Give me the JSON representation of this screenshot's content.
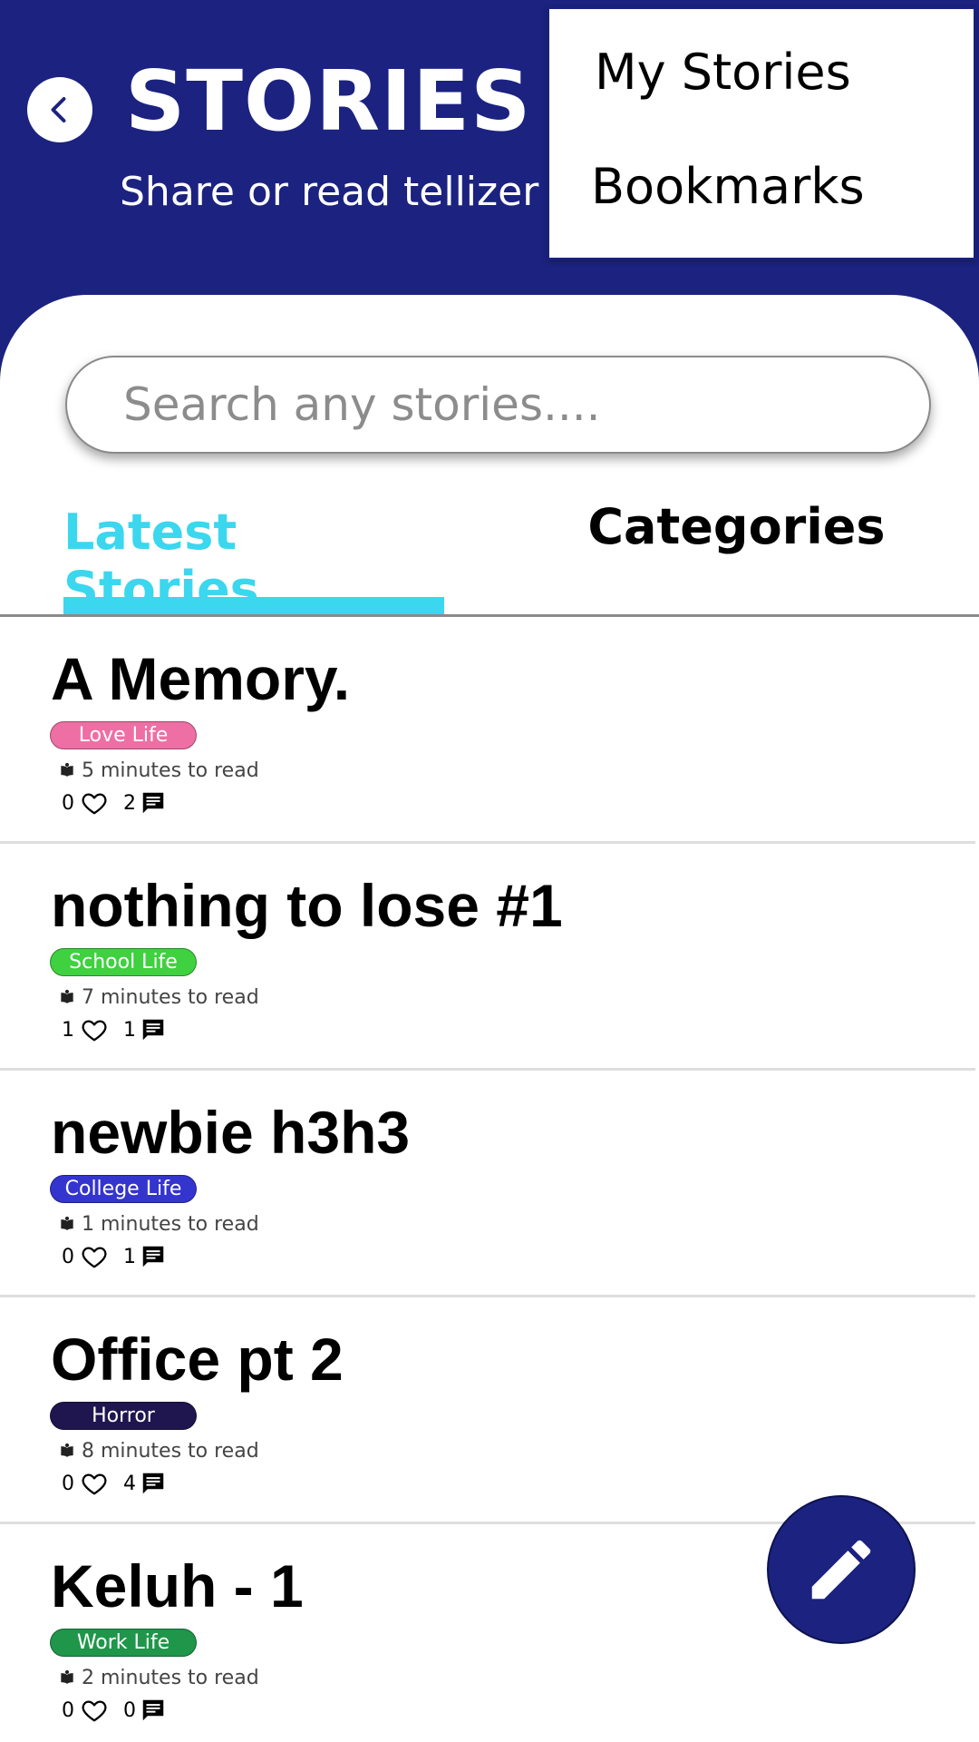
{
  "header": {
    "title": "STORIES",
    "subtitle": "Share or read tellizer",
    "back_icon": "chevron-left-icon",
    "background_color": "#1b227f"
  },
  "menu": {
    "items": [
      "My Stories",
      "Bookmarks"
    ]
  },
  "search": {
    "placeholder": "Search any stories....",
    "value": ""
  },
  "tabs": {
    "latest": "Latest Stories",
    "categories": "Categories",
    "active": "Latest Stories",
    "active_color": "#3bd7ee"
  },
  "stories": [
    {
      "title": "A Memory.",
      "category": "Love Life",
      "category_color": "#ee6fa4",
      "read_time": "5 minutes to read",
      "likes": "0",
      "comments": "2"
    },
    {
      "title": "nothing to lose #1",
      "category": "School Life",
      "category_color": "#3fd13f",
      "read_time": "7 minutes to read",
      "likes": "1",
      "comments": "1"
    },
    {
      "title": "newbie h3h3",
      "category": "College Life",
      "category_color": "#3434cf",
      "read_time": "1 minutes to read",
      "likes": "0",
      "comments": "1"
    },
    {
      "title": "Office pt 2",
      "category": "Horror",
      "category_color": "#1f1650",
      "read_time": "8 minutes to read",
      "likes": "0",
      "comments": "4"
    },
    {
      "title": "Keluh - 1",
      "category": "Work Life",
      "category_color": "#1f964a",
      "read_time": "2 minutes to read",
      "likes": "0",
      "comments": "0"
    }
  ],
  "fab": {
    "icon": "pencil-icon"
  }
}
